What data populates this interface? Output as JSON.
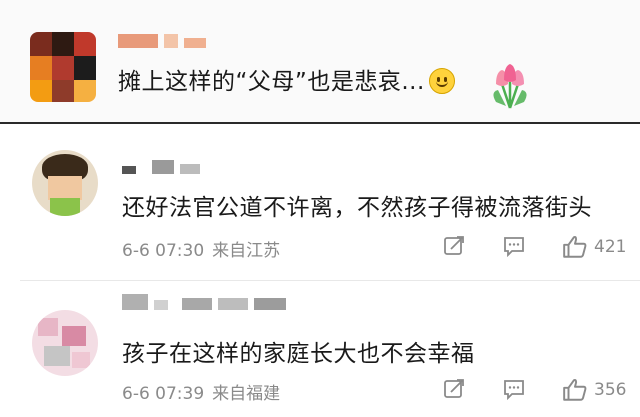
{
  "comments": [
    {
      "text": "摊上这样的“父母”也是悲哀...",
      "emoji_icons": [
        "smile-emoji-icon",
        "tulip-bouquet-icon"
      ]
    },
    {
      "text": "还好法官公道不许离，不然孩子得被流落街头",
      "date": "6-6 07:30",
      "source": "来自江苏",
      "likes": "421"
    },
    {
      "text": "孩子在这样的家庭长大也不会幸福",
      "date": "6-6 07:39",
      "source": "来自福建",
      "likes": "356"
    }
  ],
  "action_icons": [
    "share-icon",
    "comment-icon",
    "like-icon"
  ],
  "colors": {
    "meta_text": "#8a8a8a",
    "divider": "#2a2a2a",
    "tulip": "#f58fa8",
    "smile": "#ffd23c"
  }
}
